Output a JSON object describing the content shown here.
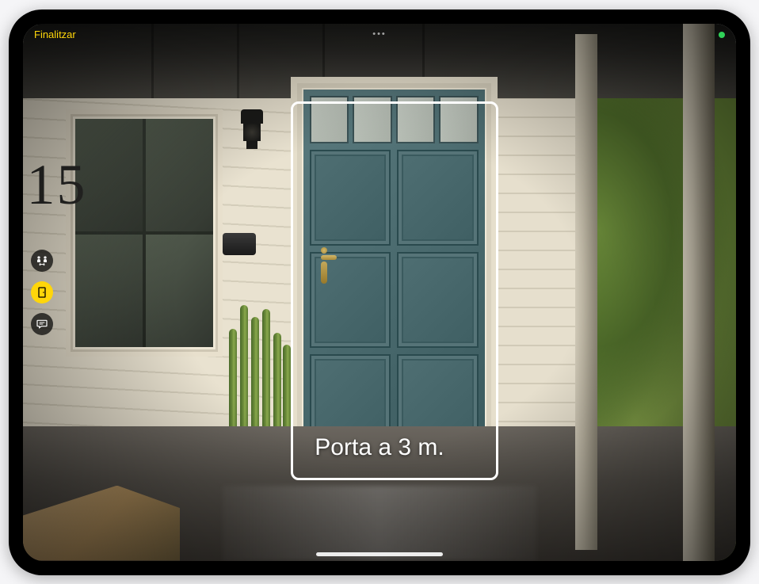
{
  "topBar": {
    "doneLabel": "Finalitzar",
    "moreGlyph": "•••"
  },
  "detection": {
    "label": "Porta a 3 m."
  },
  "houseNumber": "15",
  "controls": {
    "peopleDistance": "people-distance",
    "doorDetection": "door-detection",
    "imageDescriptions": "image-descriptions"
  }
}
